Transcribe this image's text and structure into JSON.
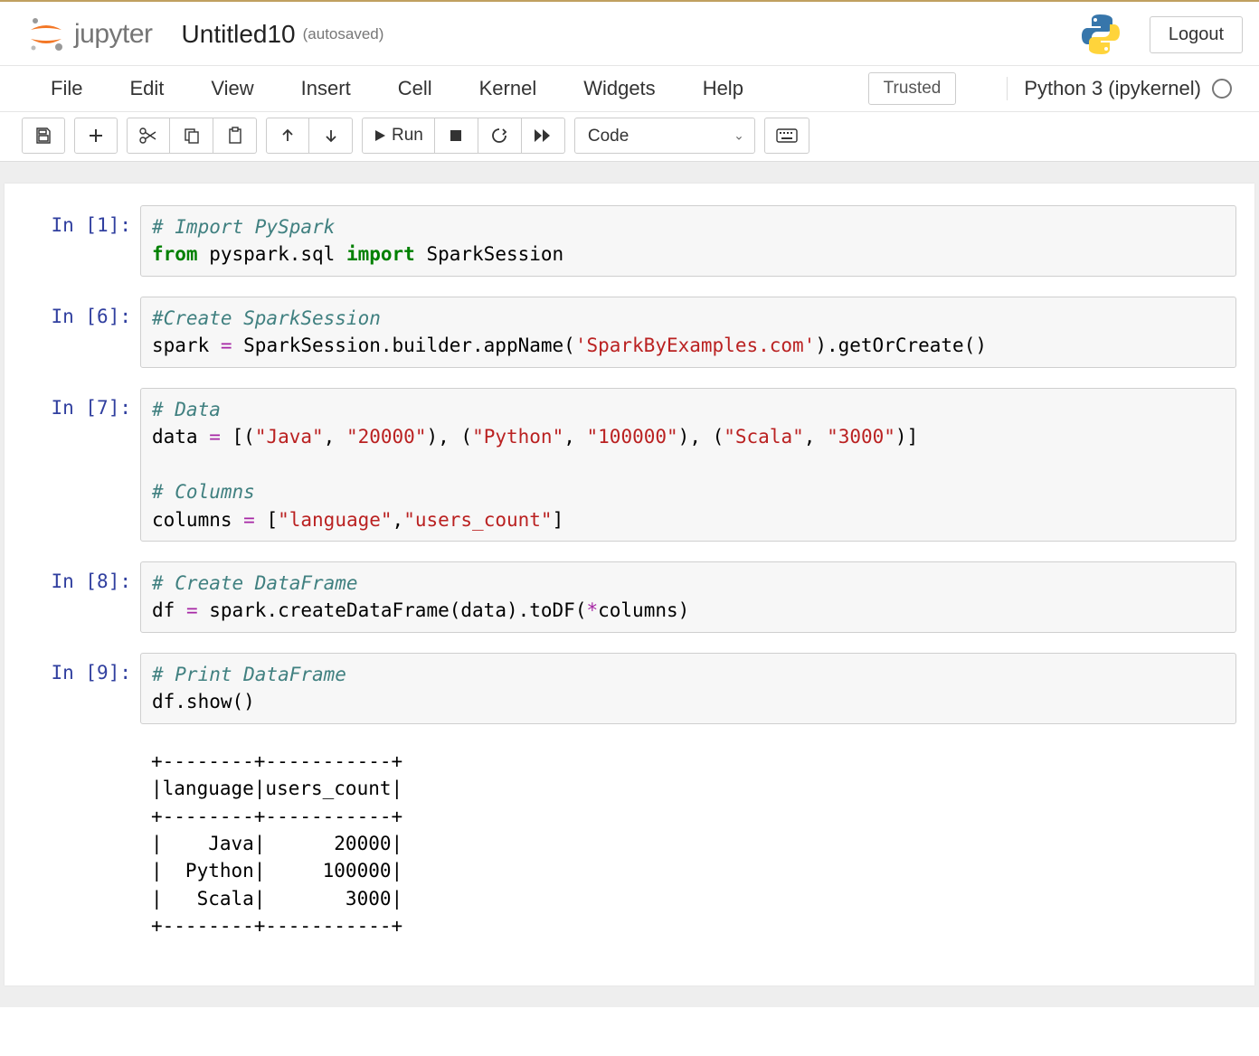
{
  "header": {
    "logo_text": "jupyter",
    "notebook_title": "Untitled10",
    "saved_status": "(autosaved)",
    "logout_label": "Logout"
  },
  "menubar": {
    "items": [
      "File",
      "Edit",
      "View",
      "Insert",
      "Cell",
      "Kernel",
      "Widgets",
      "Help"
    ],
    "trusted_label": "Trusted",
    "kernel_name": "Python 3 (ipykernel)"
  },
  "toolbar": {
    "run_label": "Run",
    "celltype_value": "Code"
  },
  "cells": [
    {
      "prompt": "In [1]:",
      "tokens": [
        {
          "t": "# Import PySpark",
          "c": "cm-comment"
        },
        {
          "t": "\n"
        },
        {
          "t": "from",
          "c": "cm-keyword"
        },
        {
          "t": " pyspark.sql "
        },
        {
          "t": "import",
          "c": "cm-keyword"
        },
        {
          "t": " SparkSession"
        }
      ]
    },
    {
      "prompt": "In [6]:",
      "tokens": [
        {
          "t": "#Create SparkSession",
          "c": "cm-comment"
        },
        {
          "t": "\n"
        },
        {
          "t": "spark "
        },
        {
          "t": "=",
          "c": "cm-operator"
        },
        {
          "t": " SparkSession.builder.appName("
        },
        {
          "t": "'SparkByExamples.com'",
          "c": "cm-string"
        },
        {
          "t": ").getOrCreate()"
        }
      ]
    },
    {
      "prompt": "In [7]:",
      "tokens": [
        {
          "t": "# Data",
          "c": "cm-comment"
        },
        {
          "t": "\n"
        },
        {
          "t": "data "
        },
        {
          "t": "=",
          "c": "cm-operator"
        },
        {
          "t": " [("
        },
        {
          "t": "\"Java\"",
          "c": "cm-string"
        },
        {
          "t": ", "
        },
        {
          "t": "\"20000\"",
          "c": "cm-string"
        },
        {
          "t": "), ("
        },
        {
          "t": "\"Python\"",
          "c": "cm-string"
        },
        {
          "t": ", "
        },
        {
          "t": "\"100000\"",
          "c": "cm-string"
        },
        {
          "t": "), ("
        },
        {
          "t": "\"Scala\"",
          "c": "cm-string"
        },
        {
          "t": ", "
        },
        {
          "t": "\"3000\"",
          "c": "cm-string"
        },
        {
          "t": ")]\n\n"
        },
        {
          "t": "# Columns",
          "c": "cm-comment"
        },
        {
          "t": "\n"
        },
        {
          "t": "columns "
        },
        {
          "t": "=",
          "c": "cm-operator"
        },
        {
          "t": " ["
        },
        {
          "t": "\"language\"",
          "c": "cm-string"
        },
        {
          "t": ","
        },
        {
          "t": "\"users_count\"",
          "c": "cm-string"
        },
        {
          "t": "]"
        }
      ]
    },
    {
      "prompt": "In [8]:",
      "tokens": [
        {
          "t": "# Create DataFrame",
          "c": "cm-comment"
        },
        {
          "t": "\n"
        },
        {
          "t": "df "
        },
        {
          "t": "=",
          "c": "cm-operator"
        },
        {
          "t": " spark.createDataFrame(data).toDF("
        },
        {
          "t": "*",
          "c": "cm-operator"
        },
        {
          "t": "columns)"
        }
      ]
    },
    {
      "prompt": "In [9]:",
      "tokens": [
        {
          "t": "# Print DataFrame",
          "c": "cm-comment"
        },
        {
          "t": "\n"
        },
        {
          "t": "df.show()"
        }
      ],
      "output": "+--------+-----------+\n|language|users_count|\n+--------+-----------+\n|    Java|      20000|\n|  Python|     100000|\n|   Scala|       3000|\n+--------+-----------+\n"
    }
  ]
}
